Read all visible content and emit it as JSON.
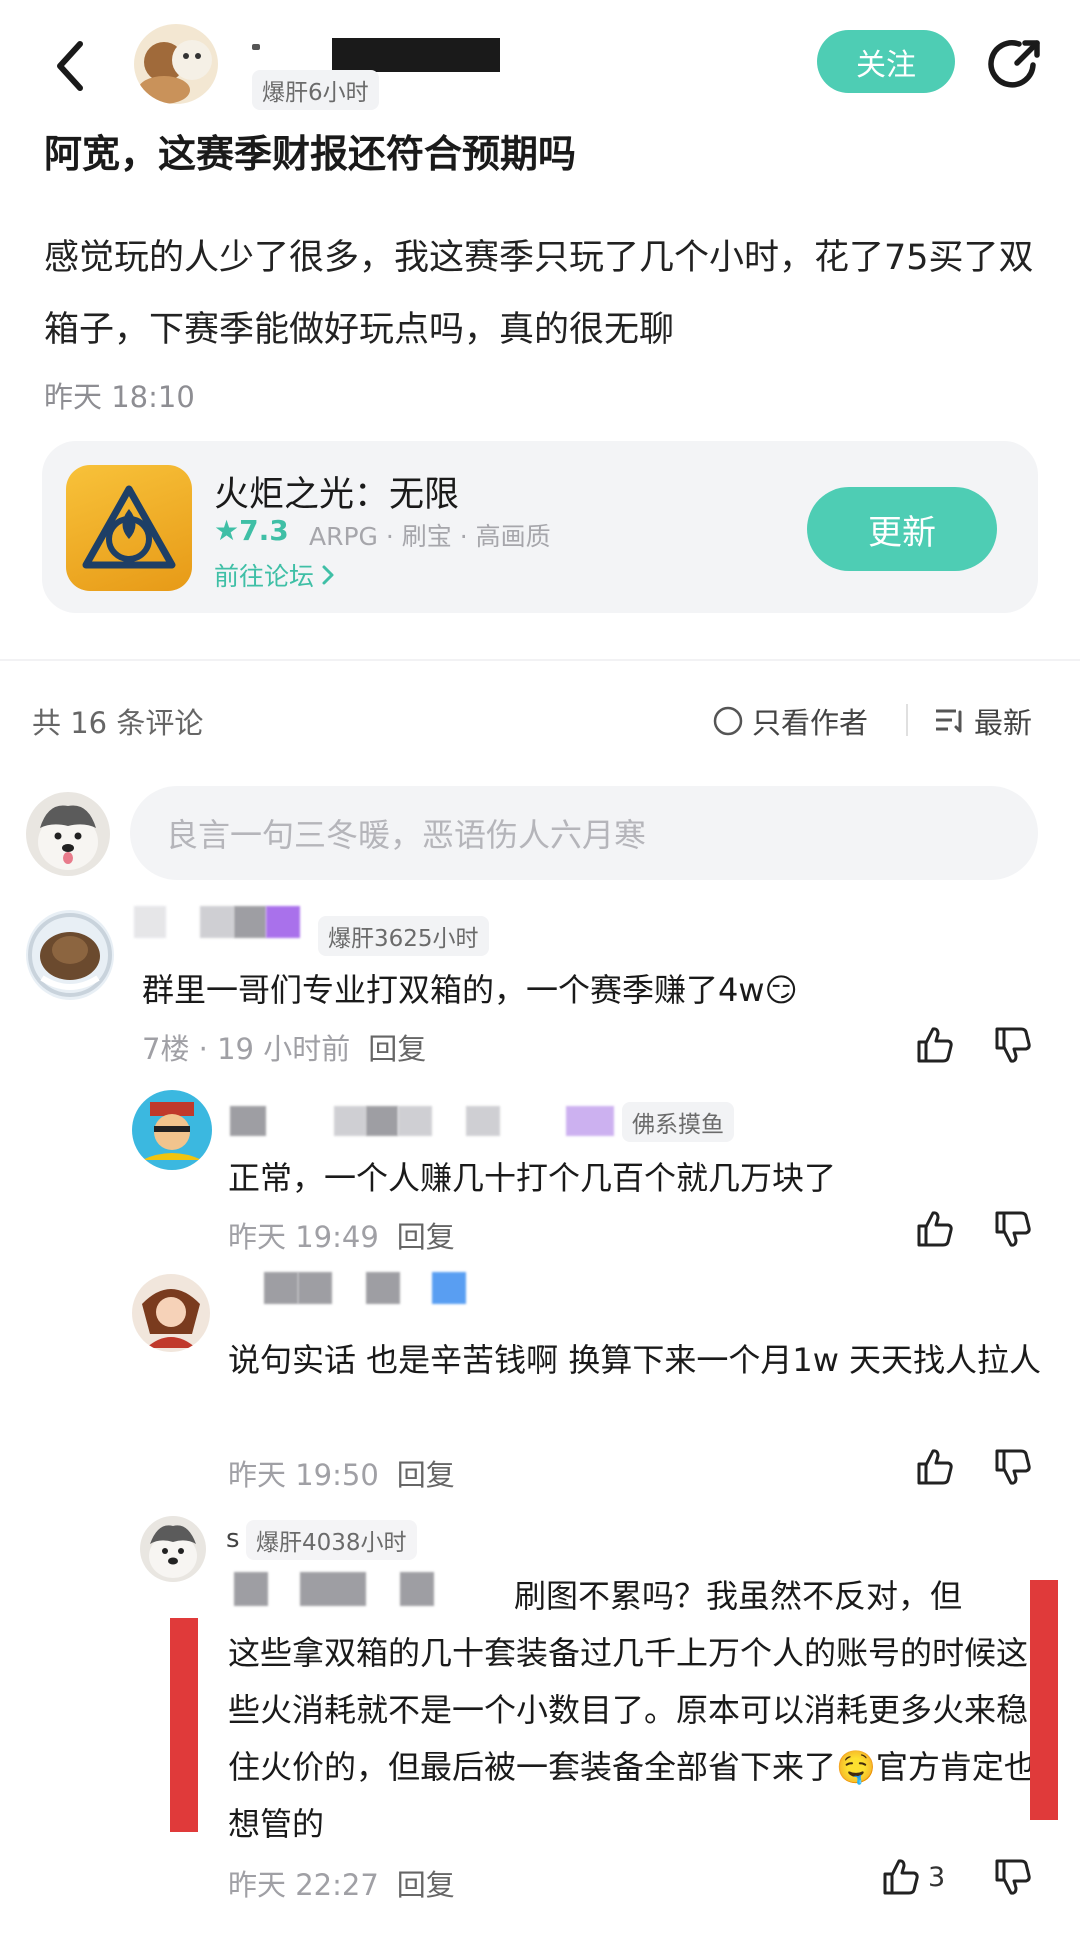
{
  "header": {
    "author_badge": "爆肝6小时",
    "follow_label": "关注"
  },
  "post": {
    "title": "阿宽，这赛季财报还符合预期吗",
    "body": "感觉玩的人少了很多，我这赛季只玩了几个小时，花了75买了双箱子，下赛季能做好玩点吗，真的很无聊",
    "time": "昨天 18:10"
  },
  "game_card": {
    "name": "火炬之光：无限",
    "rating": "★7.3",
    "tags": "ARPG · 刷宝 · 高画质",
    "forum_link": "前往论坛",
    "update_label": "更新"
  },
  "comments_header": {
    "count_label": "共 16 条评论",
    "author_only_label": "只看作者",
    "sort_label": "最新"
  },
  "comment_input": {
    "placeholder": "良言一句三冬暖，恶语伤人六月寒"
  },
  "comments": [
    {
      "badge": "爆肝3625小时",
      "text": "群里一哥们专业打双箱的，一个赛季赚了4w",
      "emoji": "😏",
      "meta": "7楼 · 19 小时前",
      "reply": "回复"
    },
    {
      "badge": "佛系摸鱼",
      "text": "正常，一个人赚几十打个几百个就几万块了",
      "meta": "昨天 19:49",
      "reply": "回复"
    },
    {
      "text": "说句实话 也是辛苦钱啊 换算下来一个月1w 天天找人拉人",
      "meta": "昨天 19:50",
      "reply": "回复"
    },
    {
      "name_initial": "s",
      "badge": "爆肝4038小时",
      "text_part1": "刷图不累吗？我虽然不反对，但",
      "text_rest": "这些拿双箱的几十套装备过几千上万个人的账号的时候这些火消耗就不是一个小数目了。原本可以消耗更多火来稳住火价的，但最后被一套装备全部省下来了",
      "emoji": "🤤",
      "text_end": "官方肯定也想管的",
      "meta": "昨天 22:27",
      "reply": "回复",
      "like_count": "3"
    }
  ],
  "colors": {
    "accent": "#4ecdb4",
    "annotation_red": "#e03a3a"
  }
}
